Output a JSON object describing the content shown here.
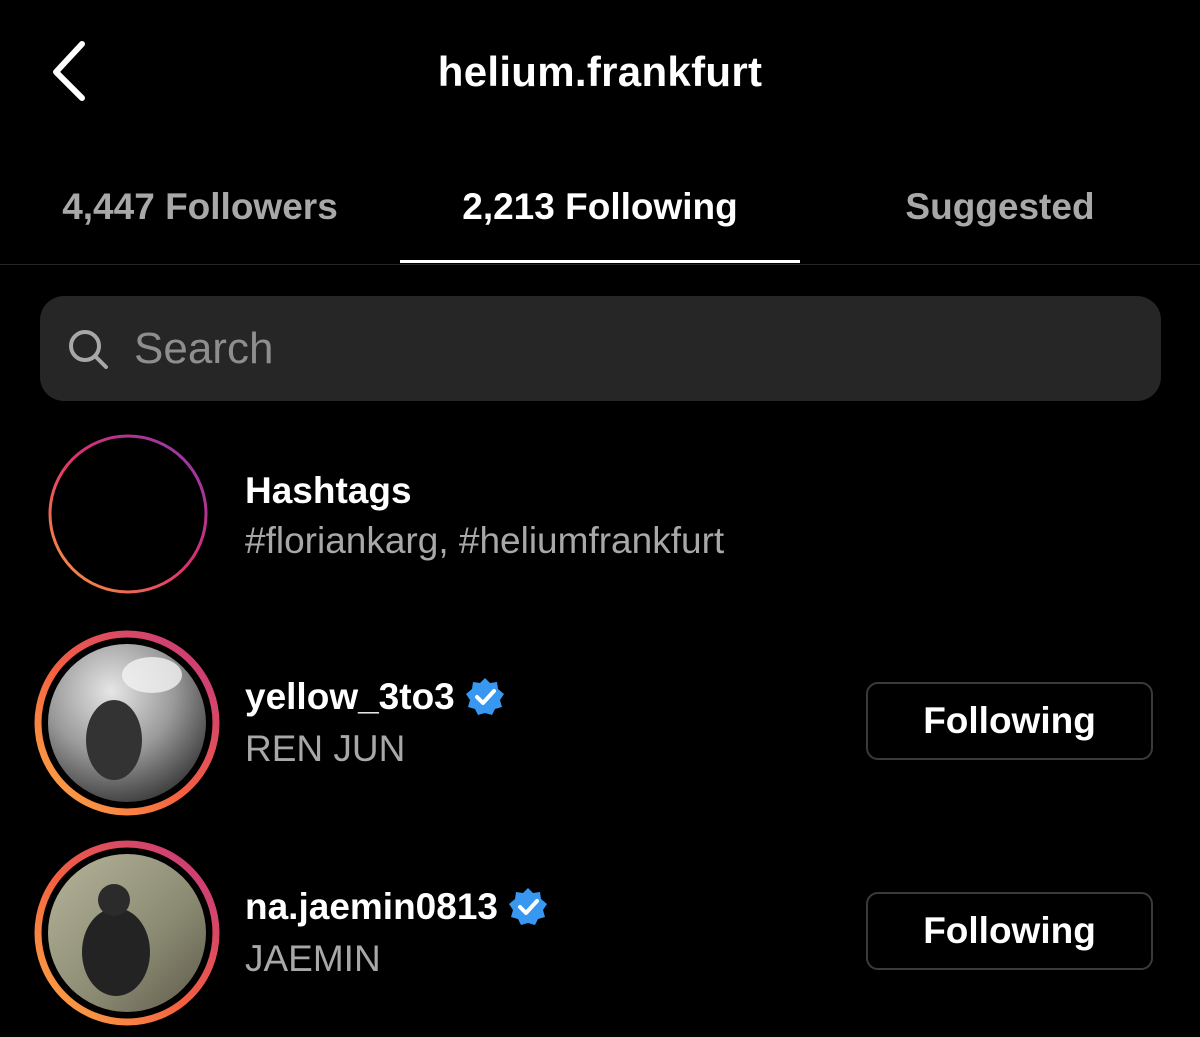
{
  "header": {
    "title": "helium.frankfurt",
    "back_icon": "chevron-left-icon"
  },
  "tabs": [
    {
      "label": "4,447 Followers",
      "active": false
    },
    {
      "label": "2,213 Following",
      "active": true
    },
    {
      "label": "Suggested",
      "active": false
    }
  ],
  "search": {
    "placeholder": "Search",
    "value": "",
    "icon": "search-icon"
  },
  "hashtags": {
    "title": "Hashtags",
    "list": "#floriankarg, #heliumfrankfurt",
    "icon": "hashtag-icon"
  },
  "accounts": [
    {
      "username": "yellow_3to3",
      "full_name": "REN JUN",
      "verified": true,
      "button_label": "Following"
    },
    {
      "username": "na.jaemin0813",
      "full_name": "JAEMIN",
      "verified": true,
      "button_label": "Following"
    }
  ],
  "colors": {
    "background": "#000000",
    "verified_blue": "#3897f0",
    "secondary_text": "#a8a8a8",
    "search_bg": "#262626"
  }
}
